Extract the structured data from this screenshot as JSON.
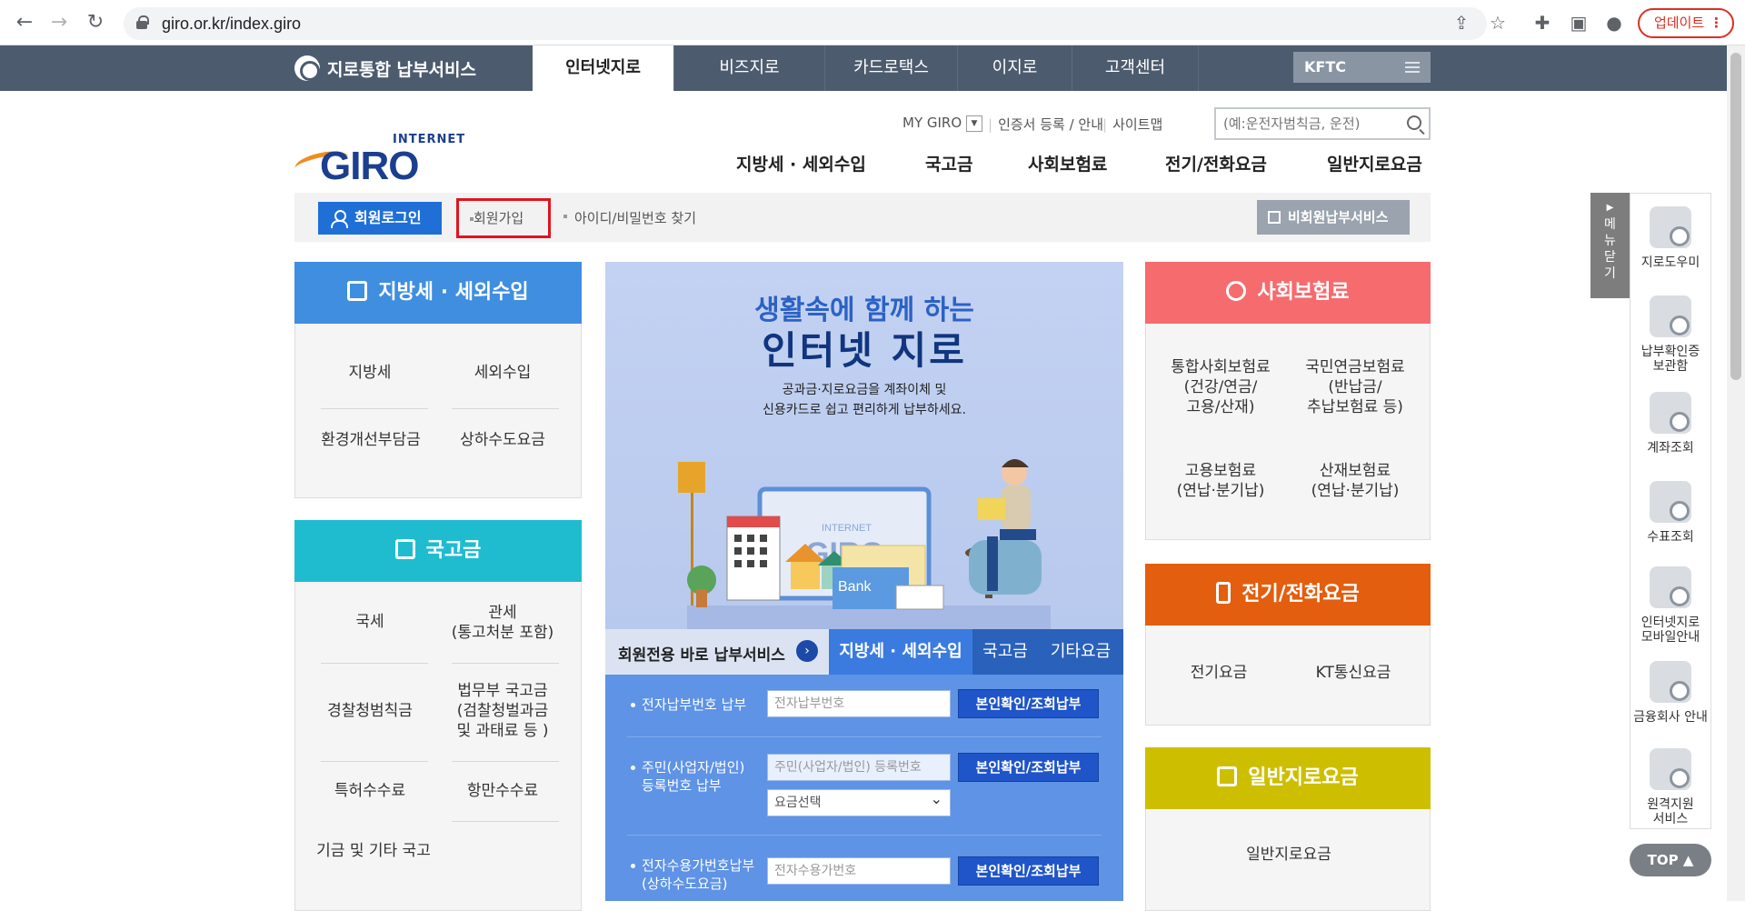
{
  "browser": {
    "url": "giro.or.kr/index.giro",
    "update_label": "업데이트"
  },
  "gnb": {
    "brand": "지로통합 납부서비스",
    "tabs": [
      "인터넷지로",
      "비즈지로",
      "카드로택스",
      "이지로",
      "고객센터"
    ],
    "kftc": "KFTC"
  },
  "header": {
    "util_links": [
      "MY GIRO",
      "인증서 등록 / 안내",
      "사이트맵"
    ],
    "search_placeholder": "(예:운전자범칙금, 운전)",
    "logo_small": "INTERNET",
    "logo_big": "GIRO",
    "main_menu": [
      "지방세 · 세외수입",
      "국고금",
      "사회보험료",
      "전기/전화요금",
      "일반지로요금"
    ]
  },
  "loginbar": {
    "login": "회원로그인",
    "join": "회원가입",
    "find": "아이디/비밀번호 찾기",
    "nonmember": "비회원납부서비스"
  },
  "left": {
    "local_tax": {
      "title": "지방세 · 세외수입",
      "items": [
        "지방세",
        "세외수입",
        "환경개선부담금",
        "상하수도요금"
      ]
    },
    "national": {
      "title": "국고금",
      "items": [
        "국세",
        "관세\n(통고처분 포함)",
        "경찰청범칙금",
        "법무부 국고금\n(검찰청벌과금\n및 과태료 등 )",
        "특허수수료",
        "항만수수료",
        "기금 및 기타 국고"
      ]
    }
  },
  "banner": {
    "line1": "생활속에 함께 하는",
    "line2": "인터넷 지로",
    "line3": "공과금·지로요금을 계좌이체 및\n신용카드로 쉽고 편리하게 납부하세요.",
    "illustration_text": [
      "INTERNET",
      "GIRO",
      "Bank"
    ]
  },
  "paytabs": {
    "member": "회원전용 바로 납부서비스",
    "tabs": [
      "지방세 · 세외수입",
      "국고금",
      "기타요금"
    ]
  },
  "payform": {
    "rows": [
      {
        "label": "전자납부번호 납부",
        "placeholder": "전자납부번호",
        "button": "본인확인/조회납부"
      },
      {
        "label": "주민(사업자/법인)\n등록번호 납부",
        "placeholder": "주민(사업자/법인) 등록번호",
        "select": "요금선택",
        "button": "본인확인/조회납부"
      },
      {
        "label": "전자수용가번호납부\n(상하수도요금)",
        "placeholder": "전자수용가번호",
        "button": "본인확인/조회납부"
      }
    ]
  },
  "right": {
    "social": {
      "title": "사회보험료",
      "items": [
        "통합사회보험료\n(건강/연금/\n고용/산재)",
        "국민연금보험료\n(반납금/\n추납보험료 등)",
        "고용보험료\n(연납·분기납)",
        "산재보험료\n(연납·분기납)"
      ]
    },
    "utility": {
      "title": "전기/전화요금",
      "items": [
        "전기요금",
        "KT통신요금"
      ]
    },
    "general": {
      "title": "일반지로요금",
      "items": [
        "일반지로요금"
      ]
    }
  },
  "quick": {
    "close_tab": "메\n뉴\n닫\n기",
    "items": [
      "지로도우미",
      "납부확인증\n보관함",
      "계좌조회",
      "수표조회",
      "인터넷지로\n모바일안내",
      "금융회사 안내",
      "원격지원\n서비스"
    ],
    "top": "TOP ▲"
  },
  "colors": {
    "gnb": "#4d5b6e",
    "local_tax": "#3f8ee0",
    "national": "#1fbcd0",
    "social": "#f56b6e",
    "utility": "#e35e0f",
    "general": "#cdbf00",
    "login": "#1f6fd6"
  }
}
